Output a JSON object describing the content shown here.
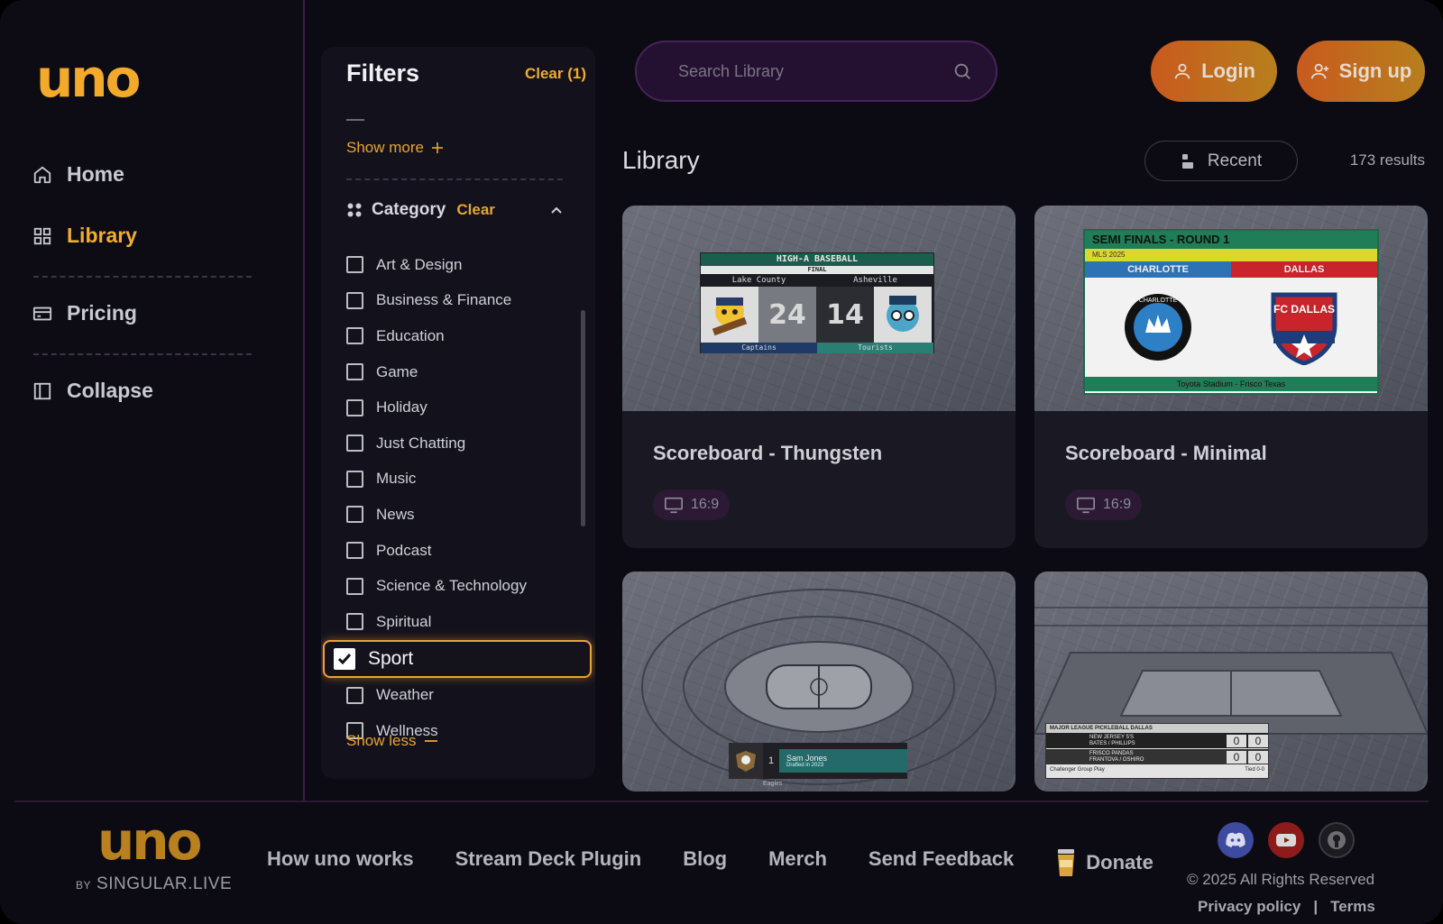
{
  "brand": {
    "logo": "uno",
    "footer_by": "BY",
    "footer_company": "SINGULAR.LIVE"
  },
  "sidebar": {
    "items": [
      {
        "label": "Home",
        "icon": "home-icon"
      },
      {
        "label": "Library",
        "icon": "grid-icon",
        "active": true
      },
      {
        "label": "Pricing",
        "icon": "card-icon"
      },
      {
        "label": "Collapse",
        "icon": "panel-icon"
      }
    ]
  },
  "filters": {
    "title": "Filters",
    "clear_label": "Clear (1)",
    "show_more": "Show more",
    "category_label": "Category",
    "category_clear": "Clear",
    "categories": [
      {
        "label": "Art & Design",
        "checked": false
      },
      {
        "label": "Business & Finance",
        "checked": false
      },
      {
        "label": "Education",
        "checked": false
      },
      {
        "label": "Game",
        "checked": false
      },
      {
        "label": "Holiday",
        "checked": false
      },
      {
        "label": "Just Chatting",
        "checked": false
      },
      {
        "label": "Music",
        "checked": false
      },
      {
        "label": "News",
        "checked": false
      },
      {
        "label": "Podcast",
        "checked": false
      },
      {
        "label": "Science & Technology",
        "checked": false
      },
      {
        "label": "Spiritual",
        "checked": false
      },
      {
        "label": "Sport",
        "checked": true
      },
      {
        "label": "Weather",
        "checked": false
      },
      {
        "label": "Wellness",
        "checked": false
      }
    ],
    "show_less": "Show less"
  },
  "header": {
    "search_placeholder": "Search Library",
    "login_label": "Login",
    "signup_label": "Sign up"
  },
  "library": {
    "title": "Library",
    "sort_label": "Recent",
    "results": "173 results",
    "cards": [
      {
        "name": "Scoreboard - Thungsten",
        "aspect": "16:9",
        "preview": {
          "title": "HIGH-A BASEBALL",
          "status": "FINAL",
          "team_a": "Lake County",
          "team_b": "Asheville",
          "score_a": "24",
          "score_b": "14",
          "nick_a": "Captains",
          "nick_b": "Tourists"
        }
      },
      {
        "name": "Scoreboard - Minimal",
        "aspect": "16:9",
        "preview": {
          "title": "SEMI FINALS - ROUND 1",
          "league": "MLS 2025",
          "team_a": "CHARLOTTE",
          "team_b": "DALLAS",
          "crest_a": "CHARLOTTE",
          "crest_b": "FC DALLAS",
          "venue": "Toyota Stadium - Frisco Texas"
        }
      },
      {
        "preview": {
          "number": "1",
          "player": "Sam Jones",
          "detail": "Drafted in 2023",
          "team": "Eagles"
        }
      },
      {
        "preview": {
          "league": "MAJOR LEAGUE PICKLEBALL DALLAS",
          "team_a": "NEW JERSEY 5'S",
          "players_a": "BATES / PHILLIPS",
          "team_b": "FRISCO PANDAS",
          "players_b": "FRANTOVA / OSHIRO",
          "score_a1": "0",
          "score_a2": "0",
          "score_b1": "0",
          "score_b2": "0",
          "round": "Challenger Group Play",
          "status": "Tied 0-0"
        }
      }
    ]
  },
  "footer": {
    "links": [
      "How uno works",
      "Stream Deck Plugin",
      "Blog",
      "Merch",
      "Send Feedback"
    ],
    "donate": "Donate",
    "copyright": "© 2025 All Rights Reserved",
    "privacy": "Privacy policy",
    "separator": "|",
    "terms": "Terms"
  },
  "colors": {
    "accent": "#f2ad2e",
    "button_gradient_start": "#c85a1e",
    "button_gradient_end": "#b77f1d",
    "background": "#0c0b13"
  }
}
